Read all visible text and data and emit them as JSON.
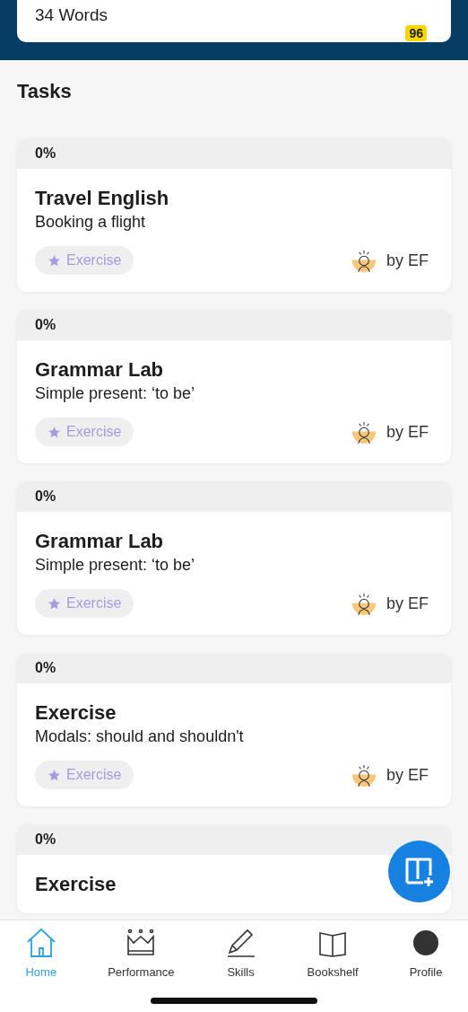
{
  "summary_card": {
    "words": "34 Words",
    "badge": "96"
  },
  "tasks_heading": "Tasks",
  "tasks": [
    {
      "progress": "0%",
      "title": "Travel English",
      "subtitle": "Booking a flight",
      "tag": "Exercise",
      "author": "by EF"
    },
    {
      "progress": "0%",
      "title": "Grammar Lab",
      "subtitle": "Simple present: ‘to be’",
      "tag": "Exercise",
      "author": "by EF"
    },
    {
      "progress": "0%",
      "title": "Grammar Lab",
      "subtitle": "Simple present: ‘to be’",
      "tag": "Exercise",
      "author": "by EF"
    },
    {
      "progress": "0%",
      "title": "Exercise",
      "subtitle": "Modals: should and shouldn't",
      "tag": "Exercise",
      "author": "by EF"
    },
    {
      "progress": "0%",
      "title": "Exercise"
    }
  ],
  "tab_bar": [
    {
      "kind": "home",
      "label": "Home",
      "selected": true
    },
    {
      "kind": "performance",
      "label": "Performance",
      "selected": false
    },
    {
      "kind": "skills",
      "label": "Skills",
      "selected": false
    },
    {
      "kind": "bookshelf",
      "label": "Bookshelf",
      "selected": false
    },
    {
      "kind": "profile",
      "label": "Profile",
      "selected": false
    }
  ]
}
